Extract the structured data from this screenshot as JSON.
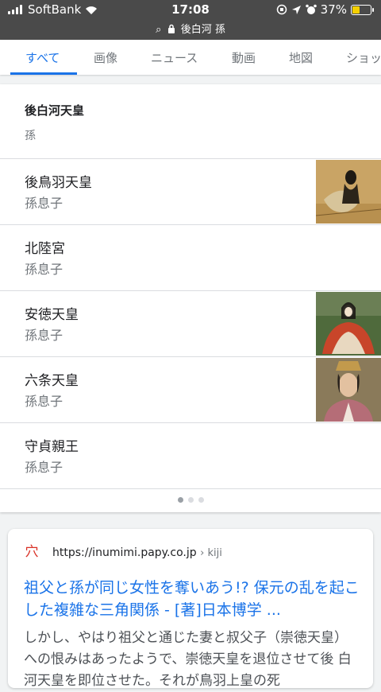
{
  "status_bar": {
    "carrier": "SoftBank",
    "time": "17:08",
    "battery": "37%",
    "battery_level": 0.37,
    "url": "後白河 孫"
  },
  "tabs": [
    {
      "label": "すべて",
      "active": true
    },
    {
      "label": "画像"
    },
    {
      "label": "ニュース"
    },
    {
      "label": "動画"
    },
    {
      "label": "地図"
    },
    {
      "label": "ショッ"
    }
  ],
  "card": {
    "title": "後白河天皇",
    "subtitle": "孫",
    "items": [
      {
        "name": "後鳥羽天皇",
        "relation": "孫息子",
        "has_image": true
      },
      {
        "name": "北陸宮",
        "relation": "孫息子",
        "has_image": false
      },
      {
        "name": "安徳天皇",
        "relation": "孫息子",
        "has_image": true
      },
      {
        "name": "六条天皇",
        "relation": "孫息子",
        "has_image": true
      },
      {
        "name": "守貞親王",
        "relation": "孫息子",
        "has_image": false
      }
    ]
  },
  "result": {
    "url": "https://inumimi.papy.co.jp",
    "path": "› kiji",
    "title": "祖父と孫が同じ女性を奪いあう!? 保元の乱を起こした複雑な三角関係 - [著]日本博学 ...",
    "snippet": "しかし、やはり祖父と通じた妻と叔父子（崇徳天皇） への恨みはあったようで、崇徳天皇を退位させて後 白河天皇を即位させた。それが鳥羽上皇の死"
  }
}
